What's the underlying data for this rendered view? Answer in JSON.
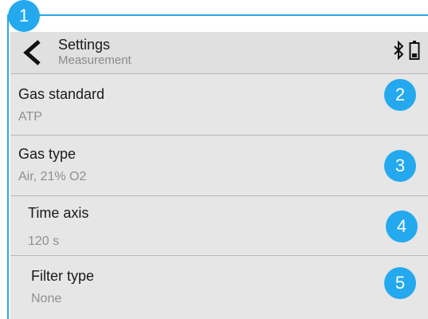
{
  "header": {
    "title": "Settings",
    "subtitle": "Measurement",
    "back_icon": "chevron-left-icon",
    "bluetooth_icon": "bluetooth-icon",
    "battery_icon": "battery-icon"
  },
  "items": [
    {
      "label": "Gas standard",
      "value": "ATP",
      "badge": "2"
    },
    {
      "label": "Gas type",
      "value": "Air, 21% O2",
      "badge": "3"
    },
    {
      "label": "Time axis",
      "value": "120 s",
      "badge": "4"
    },
    {
      "label": "Filter type",
      "value": "None",
      "badge": "5"
    }
  ],
  "annotation": {
    "badge": "1"
  },
  "colors": {
    "accent": "#24a9ef",
    "screen_bg": "#e6e6e6",
    "divider": "#b9b9b9"
  }
}
